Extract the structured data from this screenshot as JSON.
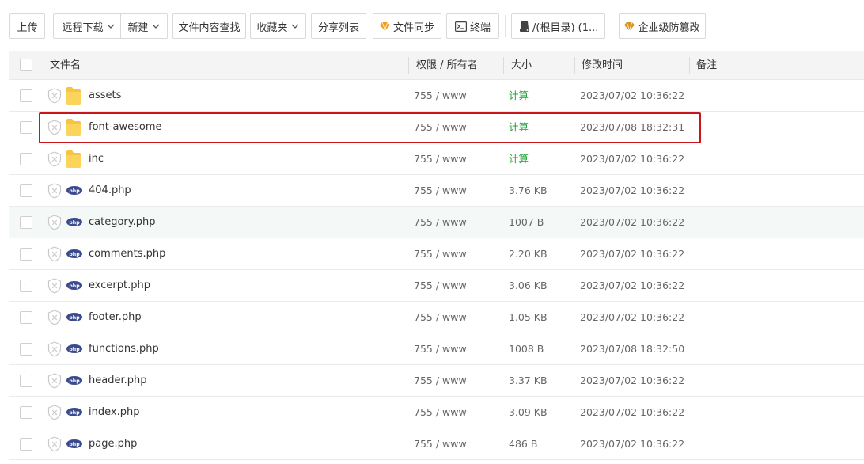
{
  "toolbar": {
    "upload": "上传",
    "remote_download": "远程下载",
    "new": "新建",
    "content_search": "文件内容查找",
    "favorites": "收藏夹",
    "share_list": "分享列表",
    "file_sync": "文件同步",
    "terminal": "终端",
    "path": "/(根目录) (1...",
    "enterprise_tamper": "企业级防篡改"
  },
  "table": {
    "headers": {
      "name": "文件名",
      "perm_owner": "权限 / 所有者",
      "size": "大小",
      "modified": "修改时间",
      "remark": "备注"
    },
    "rows": [
      {
        "name": "assets",
        "type": "folder",
        "perm": "755 / www",
        "size": "计算",
        "modified": "2023/07/02 10:36:22"
      },
      {
        "name": "font-awesome",
        "type": "folder",
        "perm": "755 / www",
        "size": "计算",
        "modified": "2023/07/08 18:32:31",
        "highlighted": true
      },
      {
        "name": "inc",
        "type": "folder",
        "perm": "755 / www",
        "size": "计算",
        "modified": "2023/07/02 10:36:22"
      },
      {
        "name": "404.php",
        "type": "php",
        "perm": "755 / www",
        "size": "3.76 KB",
        "modified": "2023/07/02 10:36:22"
      },
      {
        "name": "category.php",
        "type": "php",
        "perm": "755 / www",
        "size": "1007 B",
        "modified": "2023/07/02 10:36:22",
        "hovered": true
      },
      {
        "name": "comments.php",
        "type": "php",
        "perm": "755 / www",
        "size": "2.20 KB",
        "modified": "2023/07/02 10:36:22"
      },
      {
        "name": "excerpt.php",
        "type": "php",
        "perm": "755 / www",
        "size": "3.06 KB",
        "modified": "2023/07/02 10:36:22"
      },
      {
        "name": "footer.php",
        "type": "php",
        "perm": "755 / www",
        "size": "1.05 KB",
        "modified": "2023/07/02 10:36:22"
      },
      {
        "name": "functions.php",
        "type": "php",
        "perm": "755 / www",
        "size": "1008 B",
        "modified": "2023/07/08 18:32:50"
      },
      {
        "name": "header.php",
        "type": "php",
        "perm": "755 / www",
        "size": "3.37 KB",
        "modified": "2023/07/02 10:36:22"
      },
      {
        "name": "index.php",
        "type": "php",
        "perm": "755 / www",
        "size": "3.09 KB",
        "modified": "2023/07/02 10:36:22"
      },
      {
        "name": "page.php",
        "type": "php",
        "perm": "755 / www",
        "size": "486 B",
        "modified": "2023/07/02 10:36:22"
      }
    ]
  },
  "icons": {
    "folder": "folder-icon",
    "php": "php-file-icon",
    "protect": "shield-x-icon",
    "sync": "diamond-icon",
    "terminal": "terminal-icon",
    "disk": "disk-icon"
  },
  "colors": {
    "calc_green": "#20a53a",
    "highlight_red": "#c8161d",
    "php_badge": "#3b4a8c",
    "folder_yellow": "#f6c343",
    "gem_orange": "#f0a020"
  }
}
